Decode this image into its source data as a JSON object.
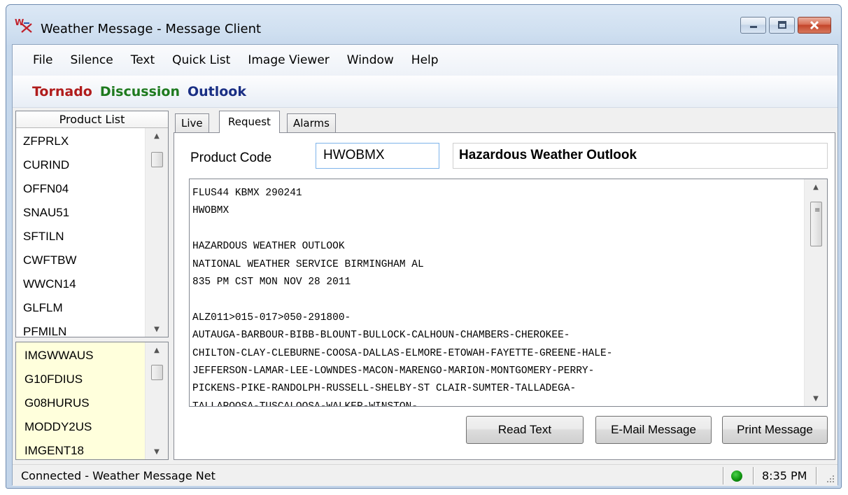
{
  "window": {
    "title": "Weather Message - Message Client"
  },
  "menu": [
    "File",
    "Silence",
    "Text",
    "Quick List",
    "Image Viewer",
    "Window",
    "Help"
  ],
  "quick": {
    "tornado": "Tornado",
    "discussion": "Discussion",
    "outlook": "Outlook"
  },
  "product_list": {
    "header": "Product List",
    "items": [
      "ZFPRLX",
      "CURIND",
      "OFFN04",
      "SNAU51",
      "SFTILN",
      "CWFTBW",
      "WWCN14",
      "GLFLM",
      "PFMILN"
    ]
  },
  "image_list": {
    "items": [
      "IMGWWAUS",
      "G10FDIUS",
      "G08HURUS",
      "MODDY2US",
      "IMGENT18"
    ]
  },
  "tabs": [
    "Live",
    "Request",
    "Alarms"
  ],
  "request": {
    "product_code_label": "Product Code",
    "product_code_value": "HWOBMX",
    "product_title": "Hazardous Weather Outlook",
    "message_lines": [
      "FLUS44 KBMX 290241",
      "HWOBMX",
      "",
      "HAZARDOUS WEATHER OUTLOOK",
      "NATIONAL WEATHER SERVICE BIRMINGHAM AL",
      "835 PM CST MON NOV 28 2011",
      "",
      "ALZ011>015-017>050-291800-",
      "AUTAUGA-BARBOUR-BIBB-BLOUNT-BULLOCK-CALHOUN-CHAMBERS-CHEROKEE-",
      "CHILTON-CLAY-CLEBURNE-COOSA-DALLAS-ELMORE-ETOWAH-FAYETTE-GREENE-HALE-",
      "JEFFERSON-LAMAR-LEE-LOWNDES-MACON-MARENGO-MARION-MONTGOMERY-PERRY-",
      "PICKENS-PIKE-RANDOLPH-RUSSELL-SHELBY-ST CLAIR-SUMTER-TALLADEGA-",
      "TALLAPOOSA-TUSCALOOSA-WALKER-WINSTON-"
    ],
    "buttons": {
      "read": "Read Text",
      "email": "E-Mail Message",
      "print": "Print Message"
    }
  },
  "status": {
    "text": "Connected - Weather Message Net",
    "time": "8:35 PM",
    "connection_color": "#119611"
  },
  "colors": {
    "tornado": "#b01c1c",
    "discussion": "#1e7a1e",
    "outlook": "#1a2f84",
    "image_list_bg": "#ffffdc"
  },
  "icons": [
    "app-logo-icon",
    "minimize-icon",
    "maximize-icon",
    "close-icon",
    "scroll-up-icon",
    "scroll-down-icon",
    "connection-status-icon",
    "resize-grip-icon"
  ]
}
